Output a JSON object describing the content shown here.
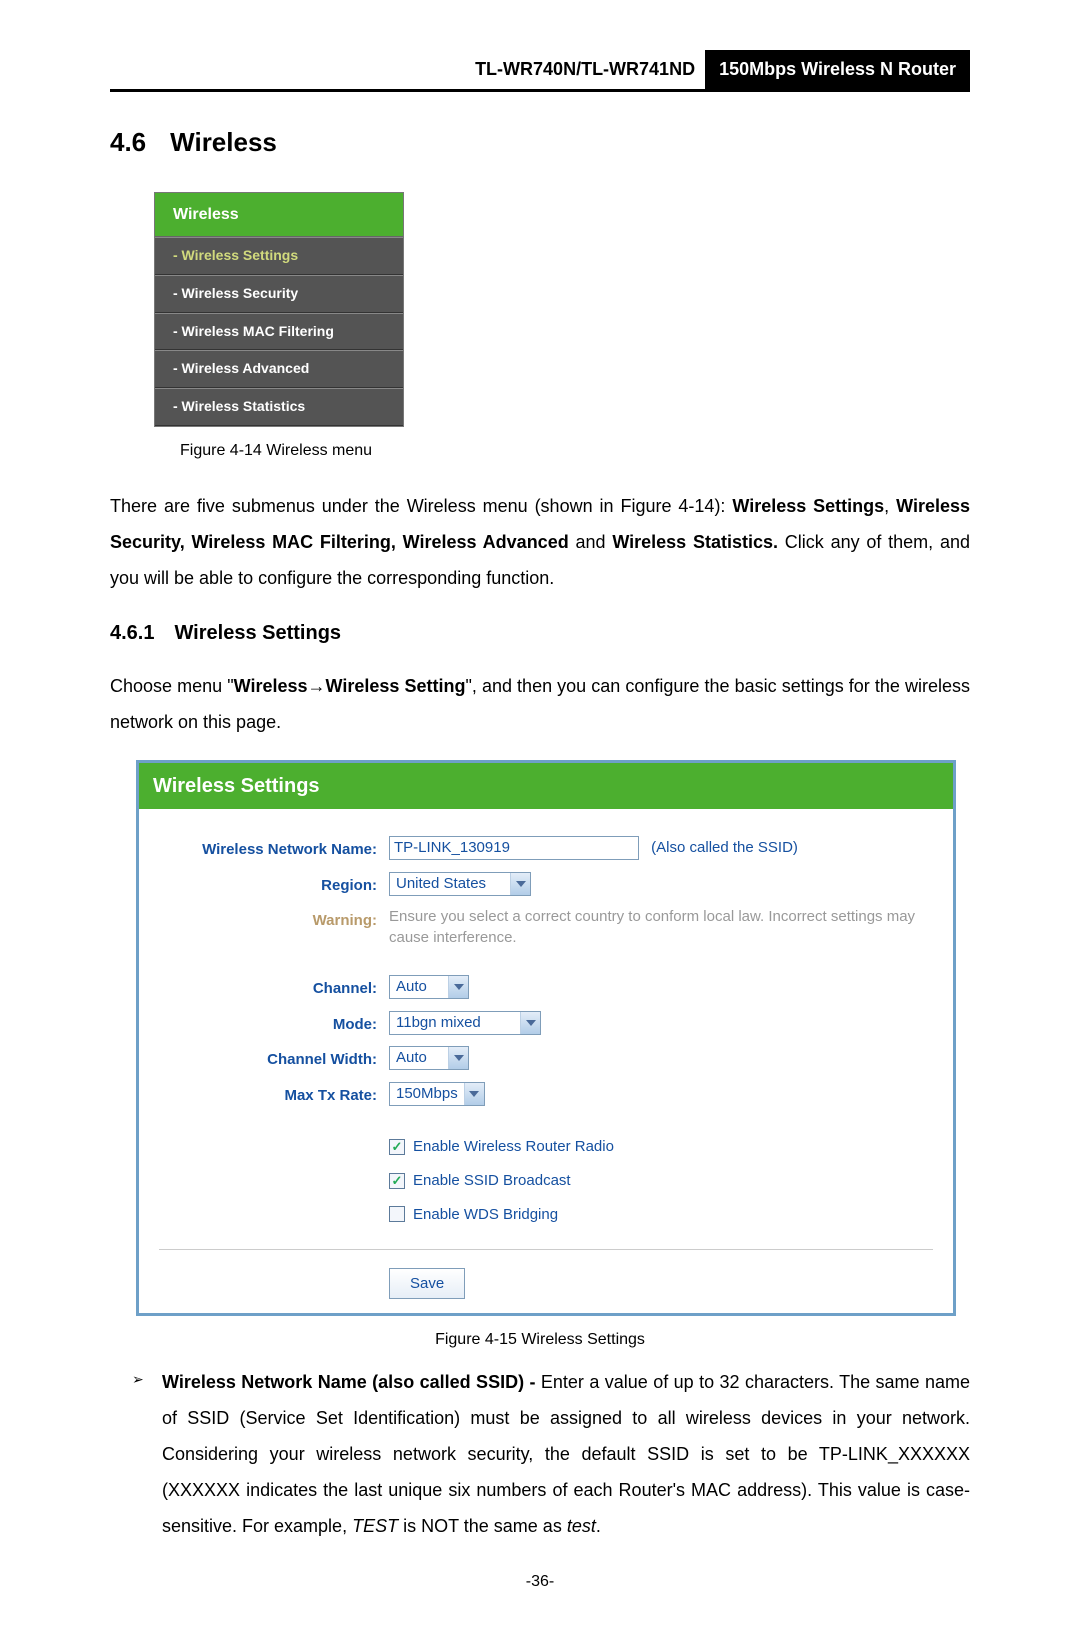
{
  "header": {
    "model": "TL-WR740N/TL-WR741ND",
    "product": "150Mbps Wireless N Router"
  },
  "section": {
    "num": "4.6",
    "title": "Wireless"
  },
  "menu": {
    "header": "Wireless",
    "items": [
      "- Wireless Settings",
      "- Wireless Security",
      "- Wireless MAC Filtering",
      "- Wireless Advanced",
      "- Wireless Statistics"
    ]
  },
  "fig14_caption": "Figure 4-14    Wireless menu",
  "para1_a": "There are five submenus under the Wireless menu (shown in ",
  "para1_b": "Figure 4-14",
  "para1_c": "): ",
  "para1_d": "Wireless Settings",
  "para1_e": ", ",
  "para1_f": "Wireless Security, Wireless MAC Filtering, Wireless Advanced",
  "para1_g": " and ",
  "para1_h": "Wireless Statistics.",
  "para1_i": " Click any of them, and you will be able to configure the corresponding function.",
  "subsection": {
    "num": "4.6.1",
    "title": "Wireless Settings"
  },
  "para2_a": "Choose menu \"",
  "para2_b": "Wireless",
  "para2_arrow": "→",
  "para2_c": "Wireless Setting",
  "para2_d": "\", and then you can configure the basic settings for the wireless network on this page.",
  "panel": {
    "title": "Wireless Settings",
    "labels": {
      "ssid": "Wireless Network Name:",
      "region": "Region:",
      "warning": "Warning:",
      "channel": "Channel:",
      "mode": "Mode:",
      "chwidth": "Channel Width:",
      "maxtx": "Max Tx Rate:"
    },
    "values": {
      "ssid": "TP-LINK_130919",
      "ssid_hint": "(Also called the SSID)",
      "region": "United States",
      "warning": "Ensure you select a correct country to conform local law. Incorrect settings may cause interference.",
      "channel": "Auto",
      "mode": "11bgn mixed",
      "chwidth": "Auto",
      "maxtx": "150Mbps"
    },
    "checks": {
      "radio": "Enable Wireless Router Radio",
      "ssidbc": "Enable SSID Broadcast",
      "wds": "Enable WDS Bridging"
    },
    "save": "Save"
  },
  "fig15_caption": "Figure 4-15    Wireless Settings",
  "bullet": {
    "t1": "Wireless Network Name (also called SSID) -",
    "t2": " Enter a value of up to 32 characters. The same name of SSID (Service Set Identification) must be assigned to all wireless devices in your network. Considering your wireless network security, the default SSID is set to be TP-LINK_XXXXXX (XXXXXX indicates the last unique six numbers of each Router's MAC address). This value is case-sensitive. For example, ",
    "t3": "TEST",
    "t4": " is NOT the same as ",
    "t5": "test",
    "t6": "."
  },
  "page_num": "-36-"
}
